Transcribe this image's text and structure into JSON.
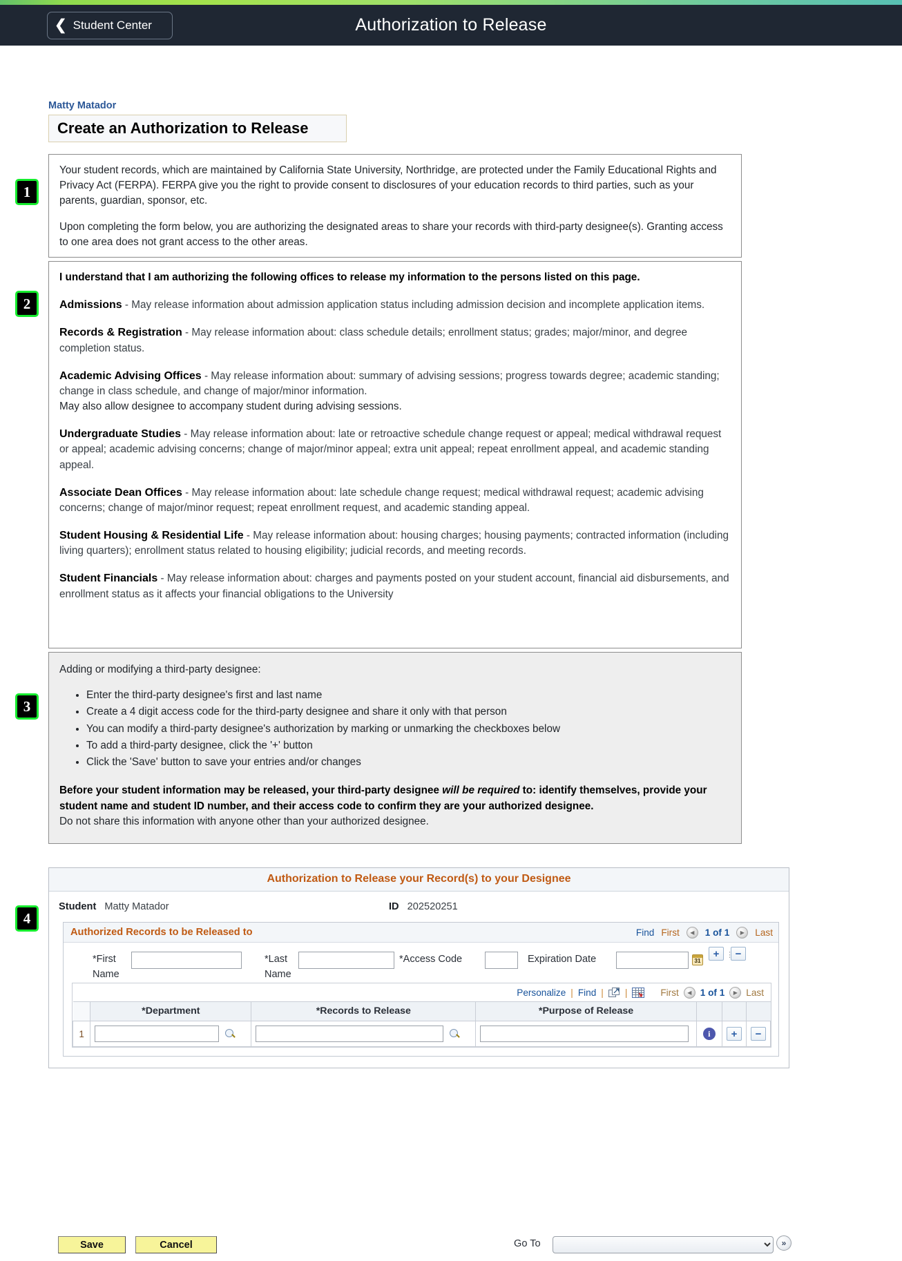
{
  "header": {
    "back_label": "Student Center",
    "back_icon": "chevron-left-icon",
    "title": "Authorization to Release"
  },
  "page": {
    "student_name": "Matty Matador",
    "title": "Create an Authorization to Release"
  },
  "markers": {
    "m1": "1",
    "m2": "2",
    "m3": "3",
    "m4": "4"
  },
  "section1": {
    "para1": "Your student records, which are maintained by California State University, Northridge, are protected under the Family Educational Rights and Privacy Act (FERPA). FERPA give you the right to provide consent to disclosures of your education records to third parties, such as your parents, guardian, sponsor, etc.",
    "para2": "Upon completing the form below, you are authorizing the designated areas to share your records with third-party designee(s). Granting access to one area does not grant access to the other areas."
  },
  "section2": {
    "lead": "I understand that I am authorizing the following offices to release my information to the persons listed on this page.",
    "offices": [
      {
        "name": "Admissions",
        "desc": " - May release information about admission application status including admission decision and incomplete application items."
      },
      {
        "name": "Records & Registration",
        "desc": " - May release information about: class schedule details; enrollment status; grades; major/minor, and degree completion status."
      },
      {
        "name": "Academic Advising Offices",
        "desc": " - May release information about: summary of advising sessions; progress towards degree; academic standing; change in class schedule, and change of major/minor information.",
        "desc2": "May also allow designee to accompany student during advising sessions."
      },
      {
        "name": "Undergraduate Studies",
        "desc": " - May release information about: late or retroactive schedule change request or appeal; medical withdrawal request or appeal; academic advising concerns; change of major/minor appeal; extra unit appeal; repeat enrollment appeal, and academic standing appeal."
      },
      {
        "name": "Associate Dean Offices",
        "desc": " - May release information about: late schedule change request; medical withdrawal request; academic advising concerns; change of major/minor request; repeat enrollment request, and academic standing appeal."
      },
      {
        "name": "Student Housing & Residential Life",
        "desc": " - May release information about: housing charges; housing payments; contracted information (including living quarters); enrollment status related to housing eligibility; judicial records, and meeting records."
      },
      {
        "name": "Student Financials",
        "desc": " - May release information about: charges and payments posted on your student account, financial aid disbursements, and enrollment status as it affects your financial obligations to the University"
      }
    ]
  },
  "section3": {
    "heading": "Adding or modifying a third-party designee:",
    "bullets": [
      "Enter the third-party designee's first and last name",
      "Create a 4 digit access code for the third-party designee and share it only with that person",
      "You can modify a third-party designee's authorization by marking or unmarking the checkboxes below",
      "To add a third-party designee, click the '+' button",
      "Click the 'Save' button to save your entries and/or changes"
    ],
    "note_a": "Before your student information may be released, your third-party designee ",
    "note_em": "will be required",
    "note_b": " to: identify themselves, provide your student name and student ID number, and their access code to confirm they are your authorized designee.",
    "note_plain": "Do not share this information with anyone other than your authorized designee."
  },
  "section4": {
    "panel_title": "Authorization to Release your Record(s) to your Designee",
    "student_label": "Student",
    "student_value": "Matty Matador",
    "id_label": "ID",
    "id_value": "202520251",
    "inner_title": "Authorized Records to be Released to",
    "scroll": {
      "find": "Find",
      "first": "First",
      "counter": "1 of 1",
      "last": "Last",
      "prev_icon": "arrow-left-icon",
      "next_icon": "arrow-right-icon"
    },
    "fields": {
      "first_name_label": "*First",
      "first_name_label2": "Name",
      "first_name_value": "",
      "last_name_label": "*Last",
      "last_name_label2": "Name",
      "last_name_value": "",
      "access_code_label": "*Access Code",
      "access_code_value": "",
      "expiration_label": "Expiration Date",
      "expiration_value": "",
      "calendar_icon": "calendar-icon",
      "calendar_day": "31",
      "add_row_label": "+",
      "remove_row_label": "−"
    },
    "grid_tools": {
      "personalize": "Personalize",
      "find": "Find",
      "view_all_icon": "view-all-icon",
      "excel_icon": "download-to-excel-icon",
      "first": "First",
      "counter": "1 of 1",
      "last": "Last"
    },
    "grid": {
      "columns": [
        "*Department",
        "*Records to Release",
        "*Purpose of Release"
      ],
      "rows": [
        {
          "num": "1",
          "department": "",
          "records_to_release": "",
          "purpose_of_release": "",
          "info_icon": "info-icon",
          "add_label": "+",
          "remove_label": "−"
        }
      ]
    }
  },
  "footer": {
    "save_label": "Save",
    "cancel_label": "Cancel",
    "goto_label": "Go To",
    "goto_value": "",
    "goto_go_icon": "double-chevron-right-icon"
  },
  "colors": {
    "accent_orange": "#c05a13",
    "link_blue": "#18539b",
    "header_dark": "#1f2733",
    "marker_green": "#16ec2e",
    "button_yellow": "#f7f49a"
  }
}
